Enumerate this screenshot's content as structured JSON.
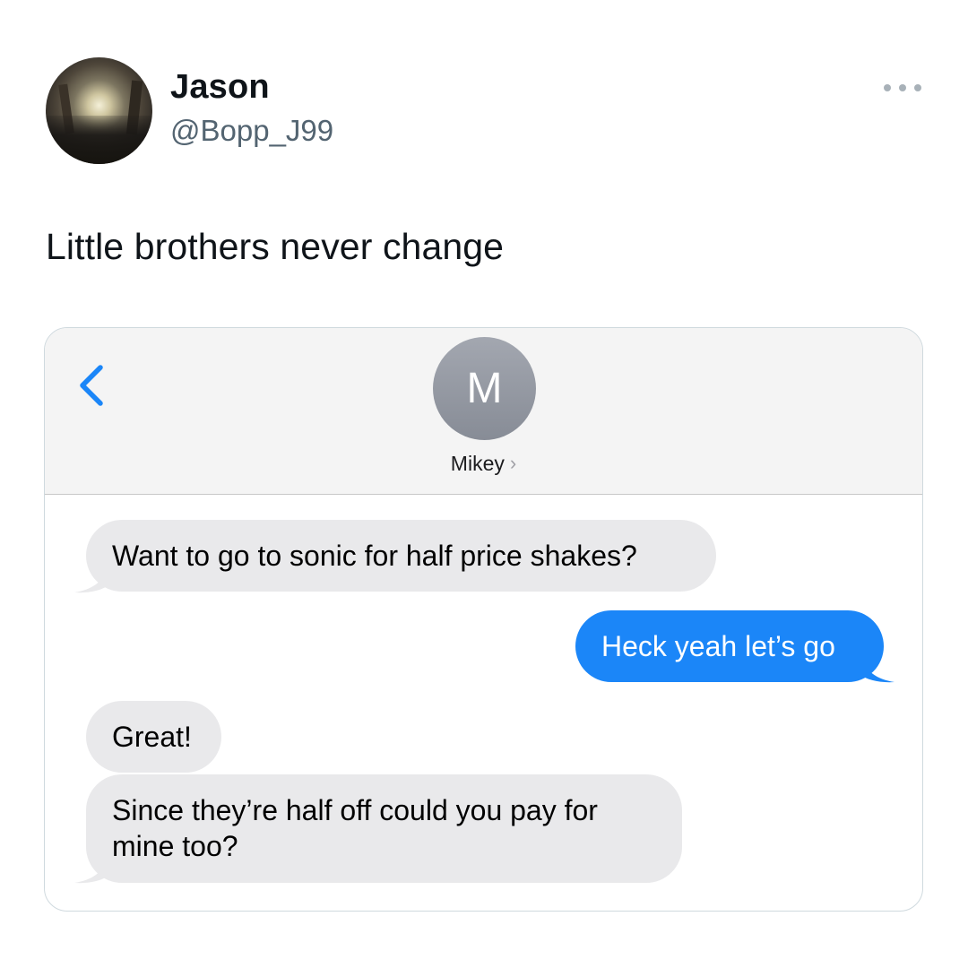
{
  "tweet": {
    "author_name": "Jason",
    "author_handle": "@Bopp_J99",
    "text": "Little brothers never change",
    "more_icon": "more-horizontal-icon"
  },
  "messages_screenshot": {
    "contact": {
      "initial": "M",
      "name": "Mikey",
      "chevron": "›"
    },
    "back_icon": "chevron-left-icon",
    "colors": {
      "incoming_bubble": "#e9e9eb",
      "outgoing_bubble": "#1b86f8",
      "accent": "#1b86f8"
    },
    "messages": [
      {
        "direction": "incoming",
        "lines": [
          "Want to go to sonic for half price shakes?"
        ]
      },
      {
        "direction": "outgoing",
        "lines": [
          "Heck yeah let’s go"
        ]
      },
      {
        "direction": "incoming",
        "lines": [
          "Great!"
        ]
      },
      {
        "direction": "incoming",
        "lines": [
          "Since they’re half off could you pay for",
          "mine too?"
        ]
      }
    ]
  }
}
